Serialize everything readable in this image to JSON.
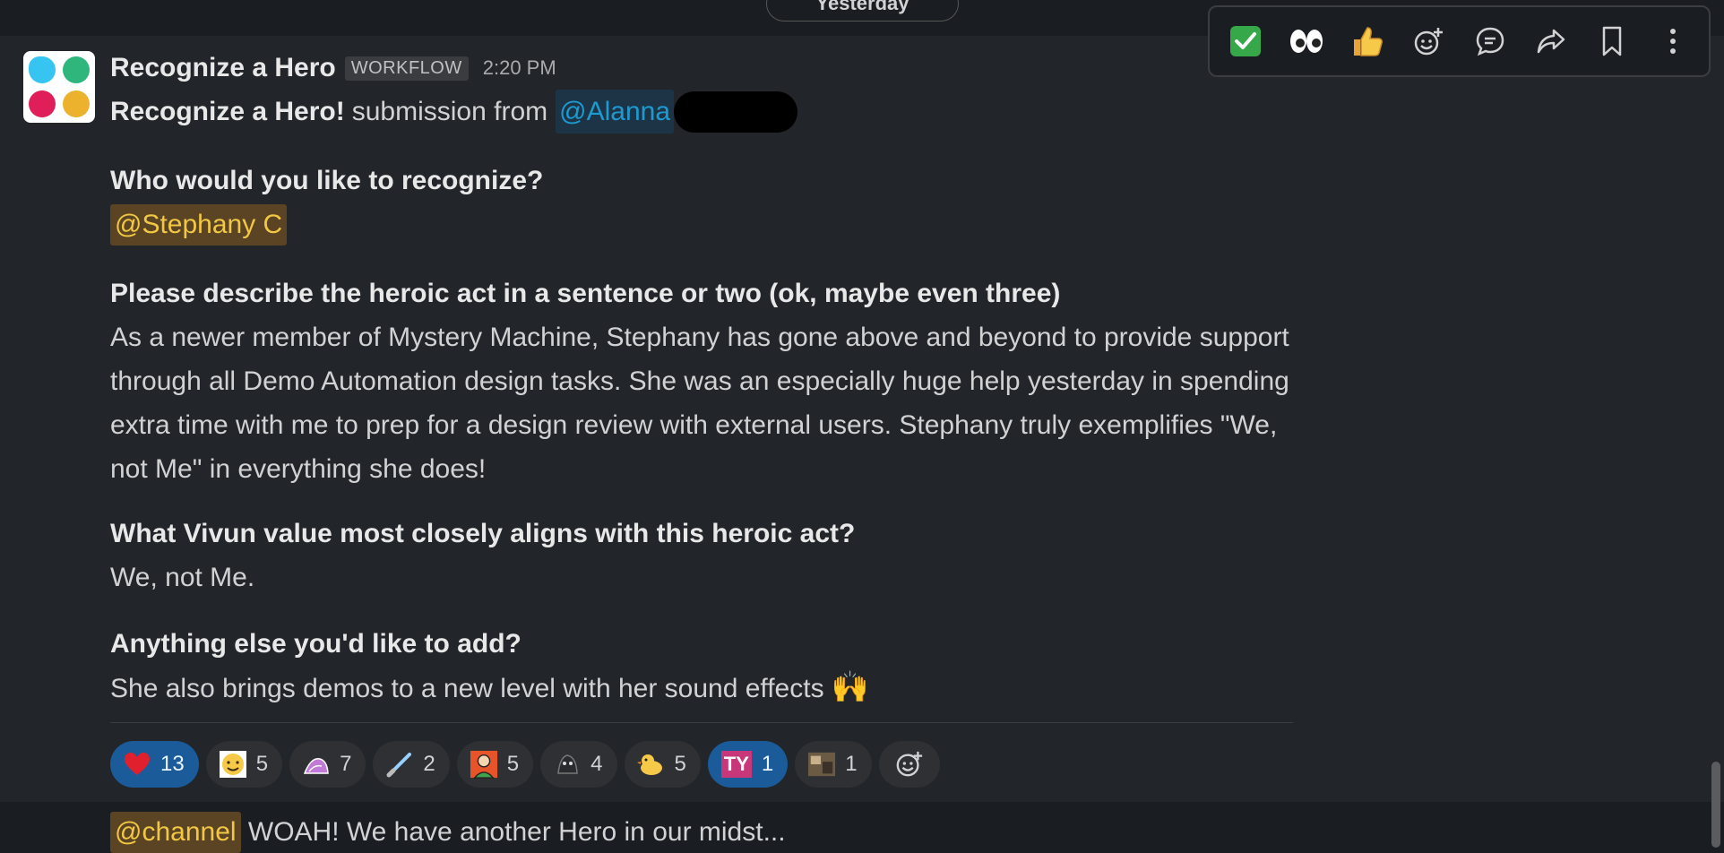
{
  "day_divider": "Yesterday",
  "message": {
    "sender": "Recognize a Hero",
    "badge": "WORKFLOW",
    "time": "2:20 PM",
    "intro_bold": "Recognize a Hero!",
    "intro_text": "submission from",
    "submitter_mention": "@Alanna",
    "q1": "Who would you like to recognize?",
    "a1_mention": "@Stephany C",
    "q2": "Please describe the heroic act in a sentence or two (ok, maybe even three)",
    "a2": "As a newer member of Mystery Machine, Stephany has gone above and beyond to provide support through all Demo Automation design tasks. She was an especially huge help yesterday in spending extra time with me to prep for a design review with external users. Stephany truly exemplifies \"We, not Me\" in everything she does!",
    "q3": "What Vivun value most closely aligns with this heroic act?",
    "a3": "We, not Me.",
    "q4": "Anything else you'd like to add?",
    "a4": "She also brings demos to a new level with her sound effects",
    "a4_emoji": "raised-hands"
  },
  "reactions": [
    {
      "icon": "red-heart",
      "count": "13",
      "active": true
    },
    {
      "icon": "blushing-face",
      "count": "5",
      "active": false
    },
    {
      "icon": "custom-wave",
      "count": "7",
      "active": false
    },
    {
      "icon": "lightsaber",
      "count": "2",
      "active": false
    },
    {
      "icon": "custom-character",
      "count": "5",
      "active": false
    },
    {
      "icon": "custom-dark",
      "count": "4",
      "active": false
    },
    {
      "icon": "duck",
      "count": "5",
      "active": false
    },
    {
      "icon": "ty-badge",
      "count": "1",
      "active": true,
      "label": "TY"
    },
    {
      "icon": "custom-photo",
      "count": "1",
      "active": false
    }
  ],
  "next_message": {
    "mention": "@channel",
    "text": "WOAH! We have another Hero in our midst..."
  },
  "toolbar": [
    "check-mark",
    "eyes",
    "thumbs-up",
    "add-reaction",
    "reply-in-thread",
    "share",
    "bookmark",
    "more-actions"
  ],
  "colors": {
    "mention_blue": "#1d9bd1",
    "mention_yellow": "#f2c744",
    "active_reaction": "#1b5b9a"
  }
}
